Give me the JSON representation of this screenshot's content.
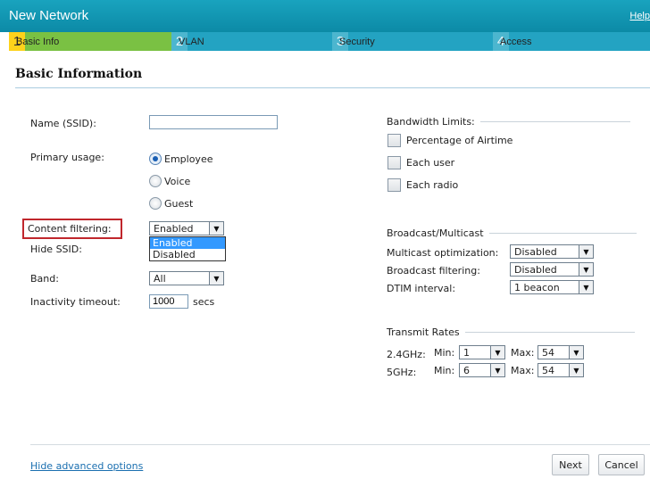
{
  "window": {
    "title": "New Network",
    "help": "Help"
  },
  "steps": [
    {
      "num": "1",
      "label": "Basic Info"
    },
    {
      "num": "2",
      "label": "VLAN"
    },
    {
      "num": "3",
      "label": "Security"
    },
    {
      "num": "4",
      "label": "Access"
    }
  ],
  "section": {
    "title": "Basic Information"
  },
  "form": {
    "name_label": "Name (SSID):",
    "name_value": "",
    "primary_usage_label": "Primary usage:",
    "primary_usage_options": [
      "Employee",
      "Voice",
      "Guest"
    ],
    "primary_usage_selected": "Employee",
    "content_filtering_label": "Content filtering:",
    "content_filtering_value": "Enabled",
    "content_filtering_options": [
      "Enabled",
      "Disabled"
    ],
    "hide_ssid_label": "Hide SSID:",
    "band_label": "Band:",
    "band_value": "All",
    "inactivity_label": "Inactivity timeout:",
    "inactivity_value": "1000",
    "inactivity_unit": "secs"
  },
  "bandwidth": {
    "title": "Bandwidth Limits:",
    "options": [
      "Percentage of Airtime",
      "Each user",
      "Each radio"
    ]
  },
  "broadcast": {
    "title": "Broadcast/Multicast",
    "multicast_label": "Multicast optimization:",
    "multicast_value": "Disabled",
    "broadcast_label": "Broadcast filtering:",
    "broadcast_value": "Disabled",
    "dtim_label": "DTIM interval:",
    "dtim_value": "1 beacon"
  },
  "rates": {
    "title": "Transmit Rates",
    "min_label": "Min:",
    "max_label": "Max:",
    "rows": [
      {
        "band": "2.4GHz:",
        "min": "1",
        "max": "54"
      },
      {
        "band": "5GHz:",
        "min": "6",
        "max": "54"
      }
    ]
  },
  "footer": {
    "advanced_link": "Hide advanced options",
    "next": "Next",
    "cancel": "Cancel"
  },
  "colors": {
    "header": "#0c8aa6",
    "active_step": "#7ac143",
    "step_number": "#fdd21b",
    "highlight": "#c0272d"
  }
}
